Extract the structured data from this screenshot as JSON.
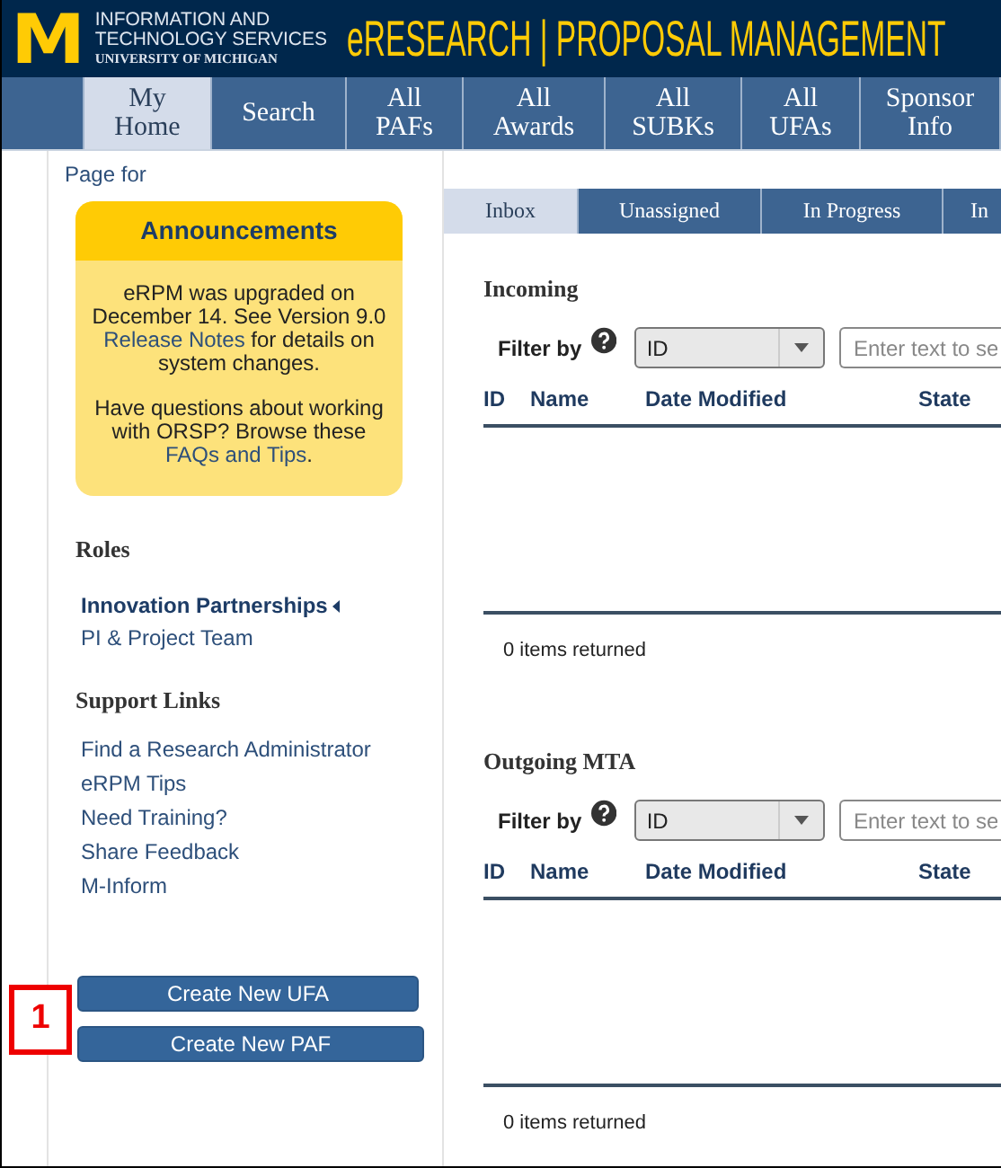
{
  "header": {
    "logo": "M",
    "org_lines": [
      "INFORMATION AND",
      "TECHNOLOGY SERVICES",
      "UNIVERSITY OF MICHIGAN"
    ],
    "title": "eRESEARCH | PROPOSAL MANAGEMENT"
  },
  "nav": [
    {
      "label": [
        "My",
        "Home"
      ],
      "selected": true
    },
    {
      "label": [
        "Search"
      ],
      "selected": false
    },
    {
      "label": [
        "All",
        "PAFs"
      ],
      "selected": false
    },
    {
      "label": [
        "All",
        "Awards"
      ],
      "selected": false
    },
    {
      "label": [
        "All",
        "SUBKs"
      ],
      "selected": false
    },
    {
      "label": [
        "All",
        "UFAs"
      ],
      "selected": false
    },
    {
      "label": [
        "Sponsor",
        "Info"
      ],
      "selected": false
    }
  ],
  "sidebar": {
    "page_for": "Page for",
    "announcements": {
      "title": "Announcements",
      "paragraphs": [
        [
          {
            "text": "eRPM was upgraded on December 14. See Version 9.0 "
          },
          {
            "text": "Release Notes",
            "link": true
          },
          {
            "text": " for details on system changes."
          }
        ],
        [
          {
            "text": "Have questions about working with ORSP? Browse these "
          },
          {
            "text": "FAQs and Tips",
            "link": true
          },
          {
            "text": "."
          }
        ]
      ]
    },
    "roles": {
      "title": "Roles",
      "items": [
        {
          "label": "Innovation Partnerships",
          "selected": true
        },
        {
          "label": "PI & Project Team",
          "selected": false
        }
      ]
    },
    "support_links": {
      "title": "Support Links",
      "items": [
        "Find a Research Administrator",
        "eRPM Tips",
        "Need Training?",
        "Share Feedback",
        "M-Inform"
      ]
    },
    "callout": "1",
    "buttons": [
      "Create New UFA",
      "Create New PAF"
    ]
  },
  "tabs": [
    {
      "label": "Inbox",
      "selected": true
    },
    {
      "label": "Unassigned",
      "selected": false
    },
    {
      "label": "In Progress",
      "selected": false
    },
    {
      "label": "In",
      "selected": false
    }
  ],
  "sections": [
    {
      "title": "Incoming",
      "filter_label": "Filter by",
      "select_value": "ID",
      "placeholder": "Enter text to se",
      "columns": [
        "ID",
        "Name",
        "Date Modified",
        "State"
      ],
      "footer": "0 items returned"
    },
    {
      "title": "Outgoing MTA",
      "filter_label": "Filter by",
      "select_value": "ID",
      "placeholder": "Enter text to se",
      "columns": [
        "ID",
        "Name",
        "Date Modified",
        "State"
      ],
      "footer": "0 items returned"
    }
  ]
}
